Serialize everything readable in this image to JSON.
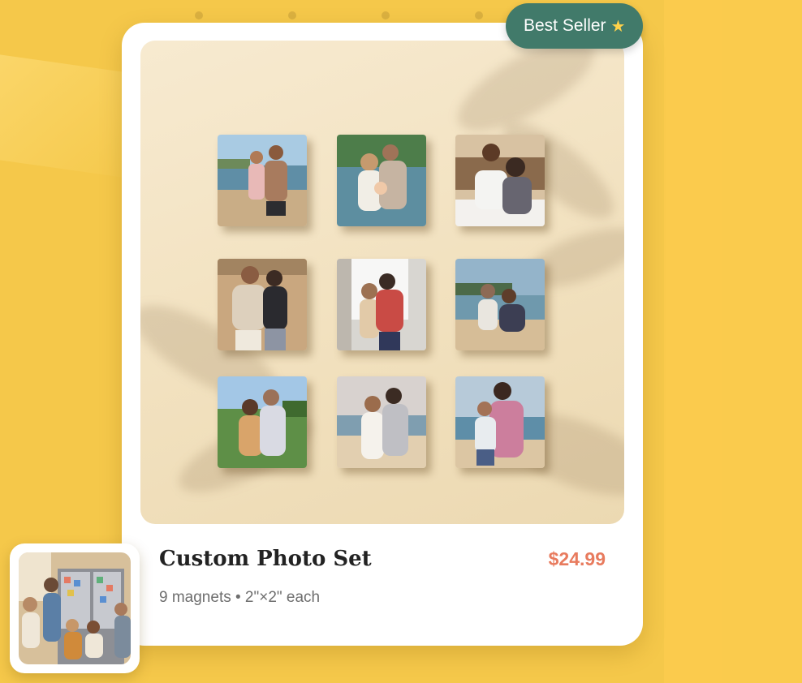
{
  "badge": {
    "label": "Best Seller",
    "icon": "star-icon"
  },
  "product": {
    "title": "Custom Photo Set",
    "price": "$24.99",
    "subtitle": "9 magnets • 2\"×2\" each"
  },
  "magnets": [
    {
      "scene": "beach-father-daughter"
    },
    {
      "scene": "lake-family-baby"
    },
    {
      "scene": "bedroom-couple"
    },
    {
      "scene": "desert-couple"
    },
    {
      "scene": "indoor-couple"
    },
    {
      "scene": "beach-family-sitting"
    },
    {
      "scene": "meadow-couple"
    },
    {
      "scene": "beach-couple"
    },
    {
      "scene": "beach-mother-child"
    }
  ],
  "thumbnail": {
    "scene": "family-at-fridge"
  },
  "colors": {
    "background": "#f5c84a",
    "badge": "#417a6a",
    "price": "#e87b5e",
    "title": "#222222"
  }
}
